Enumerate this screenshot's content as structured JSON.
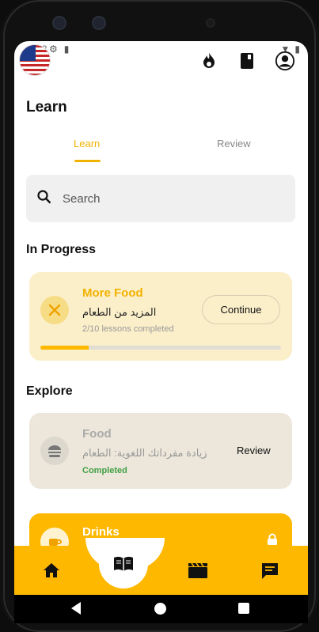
{
  "status_bar": {
    "time": "3:12",
    "left_icons": [
      "settings-icon",
      "sim-icon"
    ],
    "right_icons": [
      "wifi-icon",
      "battery-icon"
    ]
  },
  "header": {
    "flag": "us-flag",
    "icons": [
      "flame-icon",
      "book-icon",
      "account-icon"
    ]
  },
  "page": {
    "title": "Learn"
  },
  "tabs": [
    {
      "label": "Learn",
      "active": true
    },
    {
      "label": "Review",
      "active": false
    }
  ],
  "search": {
    "placeholder": "Search"
  },
  "sections": {
    "in_progress": "In Progress",
    "explore": "Explore"
  },
  "progress_card": {
    "title": "More Food",
    "subtitle": "المزيد من الطعام",
    "meta": "2/10 lessons completed",
    "button": "Continue",
    "progress": 0.2,
    "icon": "utensils-icon"
  },
  "explore_cards": [
    {
      "title": "Food",
      "subtitle": "زيادة مفرداتك اللغوية: الطعام",
      "meta": "Completed",
      "button": "Review",
      "icon": "burger-icon"
    },
    {
      "title": "Drinks",
      "icon": "cup-icon",
      "locked": true
    }
  ],
  "bottom_nav": [
    {
      "name": "home",
      "icon": "home-icon"
    },
    {
      "name": "learn",
      "icon": "book-open-icon"
    },
    {
      "name": "video",
      "icon": "clapperboard-icon"
    },
    {
      "name": "chat",
      "icon": "chat-icon"
    }
  ],
  "colors": {
    "accent": "#ffb800",
    "accent_text": "#f0b300",
    "completed": "#43a047"
  }
}
